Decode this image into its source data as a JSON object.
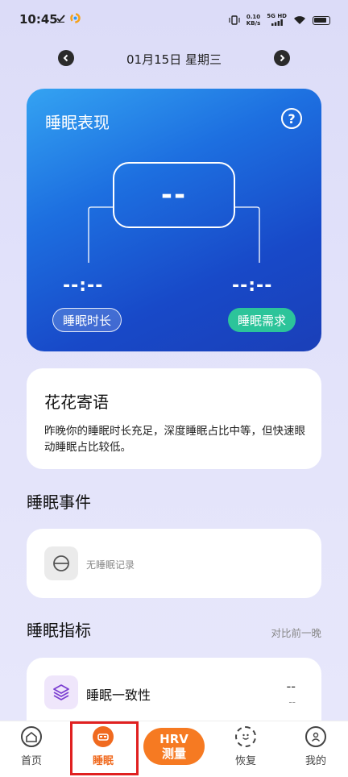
{
  "status_bar": {
    "time": "10:45",
    "net_speed_value": "0.10",
    "net_speed_unit": "KB/s",
    "network_label": "5G HD"
  },
  "date_nav": {
    "date": "01月15日 星期三"
  },
  "performance": {
    "title": "睡眠表现",
    "help": "?",
    "score": "--",
    "sleep_duration_value": "--:--",
    "sleep_need_value": "--:--",
    "sleep_duration_label": "睡眠时长",
    "sleep_need_label": "睡眠需求"
  },
  "message": {
    "title": "花花寄语",
    "text": "昨晚你的睡眠时长充足，深度睡眠占比中等，但快速眼动睡眠占比较低。"
  },
  "events": {
    "title": "睡眠事件",
    "empty_text": "无睡眠记录"
  },
  "metrics": {
    "title": "睡眠指标",
    "compare_label": "对比前一晚",
    "items": [
      {
        "label": "睡眠一致性",
        "value": "--",
        "sub": "--"
      }
    ]
  },
  "bottom_nav": {
    "home": "首页",
    "sleep": "睡眠",
    "hrv_line1": "HRV",
    "hrv_line2": "测量",
    "recover": "恢复",
    "mine": "我的"
  },
  "colors": {
    "accent_orange": "#f67a22",
    "sleep_need_green": "#2cc49a",
    "card_blue": "#1d6fe0",
    "highlight_red": "#e02020"
  }
}
